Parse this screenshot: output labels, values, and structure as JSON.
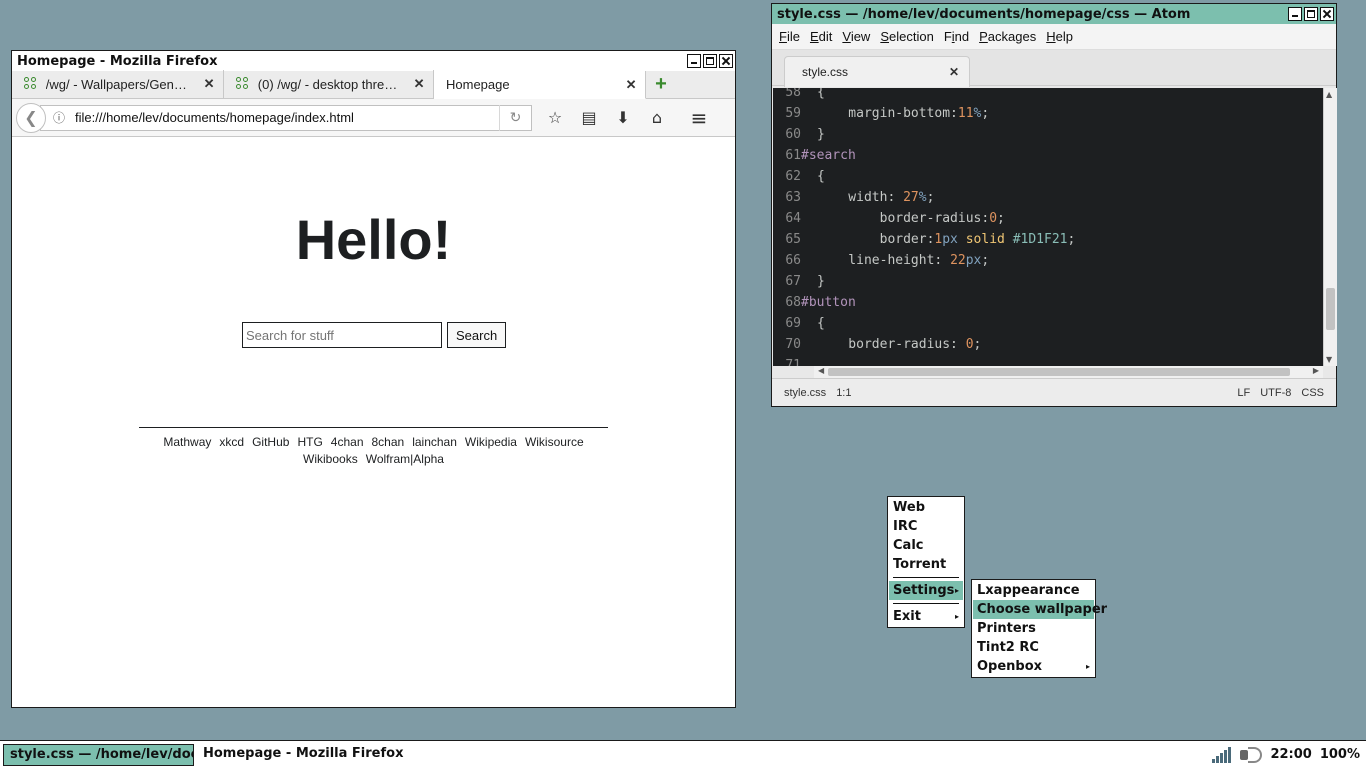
{
  "firefox": {
    "title": "Homepage - Mozilla Firefox",
    "tabs": [
      {
        "label": "/wg/ - Wallpapers/Gene…",
        "close": "✕"
      },
      {
        "label": "(0) /wg/ - desktop threa…",
        "close": "✕"
      },
      {
        "label": "Homepage",
        "close": "✕"
      }
    ],
    "new_tab": "+",
    "url": "file:///home/lev/documents/homepage/index.html",
    "page": {
      "heading": "Hello!",
      "search_placeholder": "Search for stuff",
      "search_button": "Search",
      "links": [
        "Mathway",
        "xkcd",
        "GitHub",
        "HTG",
        "4chan",
        "8chan",
        "lainchan",
        "Wikipedia",
        "Wikisource",
        "Wikibooks",
        "Wolfram|Alpha"
      ]
    }
  },
  "atom": {
    "title": "style.css — /home/lev/documents/homepage/css — Atom",
    "menu": [
      "File",
      "Edit",
      "View",
      "Selection",
      "Find",
      "Packages",
      "Help"
    ],
    "tab": "style.css",
    "tab_close": "✕",
    "lines": [
      {
        "n": "58",
        "text": "{"
      },
      {
        "n": "59",
        "text": "    margin-bottom:11%;"
      },
      {
        "n": "60",
        "text": "}"
      },
      {
        "n": "61",
        "text": "#search"
      },
      {
        "n": "62",
        "text": "{"
      },
      {
        "n": "63",
        "text": "    width: 27%;"
      },
      {
        "n": "64",
        "text": "        border-radius:0;"
      },
      {
        "n": "65",
        "text": "        border:1px solid #1D1F21;"
      },
      {
        "n": "66",
        "text": "    line-height: 22px;"
      },
      {
        "n": "67",
        "text": "}"
      },
      {
        "n": "68",
        "text": "#button"
      },
      {
        "n": "69",
        "text": "{"
      },
      {
        "n": "70",
        "text": "    border-radius: 0;"
      },
      {
        "n": "71",
        "text": "        "
      }
    ],
    "status": {
      "file": "style.css",
      "cursor": "1:1",
      "eol": "LF",
      "encoding": "UTF-8",
      "grammar": "CSS"
    }
  },
  "rootmenu": {
    "items": [
      "Web",
      "IRC",
      "Calc",
      "Torrent"
    ],
    "settings": "Settings",
    "exit": "Exit"
  },
  "submenu": {
    "items": [
      "Lxappearance",
      "Choose wallpaper",
      "Printers",
      "Tint2 RC",
      "Openbox"
    ]
  },
  "taskbar": {
    "tasks": [
      "style.css — /home/lev/doc…",
      "Homepage - Mozilla Firefox"
    ],
    "clock": "22:00",
    "battery": "100%"
  },
  "colors": {
    "accent": "#7cbfae",
    "desktop": "#7f9ba5",
    "editor_bg": "#1d1f21"
  }
}
